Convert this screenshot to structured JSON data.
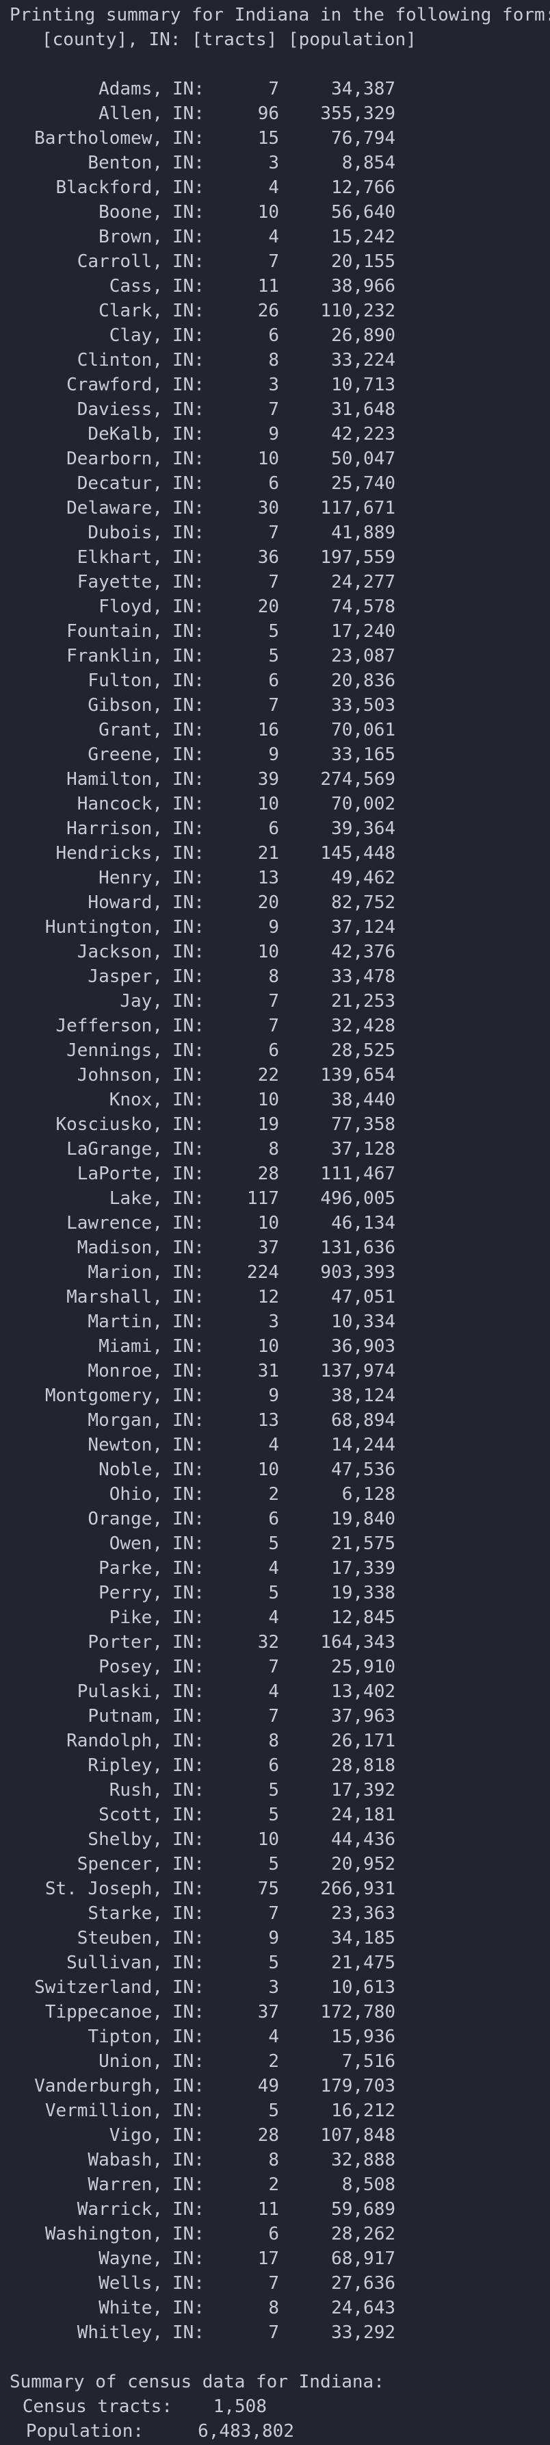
{
  "header": {
    "line1": "Printing summary for Indiana in the following form:",
    "line2": "   [county], IN: [tracts] [population]"
  },
  "state_abbr": "IN:",
  "rows": [
    {
      "county": "Adams,",
      "tracts": "7",
      "population": "34,387"
    },
    {
      "county": "Allen,",
      "tracts": "96",
      "population": "355,329"
    },
    {
      "county": "Bartholomew,",
      "tracts": "15",
      "population": "76,794"
    },
    {
      "county": "Benton,",
      "tracts": "3",
      "population": "8,854"
    },
    {
      "county": "Blackford,",
      "tracts": "4",
      "population": "12,766"
    },
    {
      "county": "Boone,",
      "tracts": "10",
      "population": "56,640"
    },
    {
      "county": "Brown,",
      "tracts": "4",
      "population": "15,242"
    },
    {
      "county": "Carroll,",
      "tracts": "7",
      "population": "20,155"
    },
    {
      "county": "Cass,",
      "tracts": "11",
      "population": "38,966"
    },
    {
      "county": "Clark,",
      "tracts": "26",
      "population": "110,232"
    },
    {
      "county": "Clay,",
      "tracts": "6",
      "population": "26,890"
    },
    {
      "county": "Clinton,",
      "tracts": "8",
      "population": "33,224"
    },
    {
      "county": "Crawford,",
      "tracts": "3",
      "population": "10,713"
    },
    {
      "county": "Daviess,",
      "tracts": "7",
      "population": "31,648"
    },
    {
      "county": "DeKalb,",
      "tracts": "9",
      "population": "42,223"
    },
    {
      "county": "Dearborn,",
      "tracts": "10",
      "population": "50,047"
    },
    {
      "county": "Decatur,",
      "tracts": "6",
      "population": "25,740"
    },
    {
      "county": "Delaware,",
      "tracts": "30",
      "population": "117,671"
    },
    {
      "county": "Dubois,",
      "tracts": "7",
      "population": "41,889"
    },
    {
      "county": "Elkhart,",
      "tracts": "36",
      "population": "197,559"
    },
    {
      "county": "Fayette,",
      "tracts": "7",
      "population": "24,277"
    },
    {
      "county": "Floyd,",
      "tracts": "20",
      "population": "74,578"
    },
    {
      "county": "Fountain,",
      "tracts": "5",
      "population": "17,240"
    },
    {
      "county": "Franklin,",
      "tracts": "5",
      "population": "23,087"
    },
    {
      "county": "Fulton,",
      "tracts": "6",
      "population": "20,836"
    },
    {
      "county": "Gibson,",
      "tracts": "7",
      "population": "33,503"
    },
    {
      "county": "Grant,",
      "tracts": "16",
      "population": "70,061"
    },
    {
      "county": "Greene,",
      "tracts": "9",
      "population": "33,165"
    },
    {
      "county": "Hamilton,",
      "tracts": "39",
      "population": "274,569"
    },
    {
      "county": "Hancock,",
      "tracts": "10",
      "population": "70,002"
    },
    {
      "county": "Harrison,",
      "tracts": "6",
      "population": "39,364"
    },
    {
      "county": "Hendricks,",
      "tracts": "21",
      "population": "145,448"
    },
    {
      "county": "Henry,",
      "tracts": "13",
      "population": "49,462"
    },
    {
      "county": "Howard,",
      "tracts": "20",
      "population": "82,752"
    },
    {
      "county": "Huntington,",
      "tracts": "9",
      "population": "37,124"
    },
    {
      "county": "Jackson,",
      "tracts": "10",
      "population": "42,376"
    },
    {
      "county": "Jasper,",
      "tracts": "8",
      "population": "33,478"
    },
    {
      "county": "Jay,",
      "tracts": "7",
      "population": "21,253"
    },
    {
      "county": "Jefferson,",
      "tracts": "7",
      "population": "32,428"
    },
    {
      "county": "Jennings,",
      "tracts": "6",
      "population": "28,525"
    },
    {
      "county": "Johnson,",
      "tracts": "22",
      "population": "139,654"
    },
    {
      "county": "Knox,",
      "tracts": "10",
      "population": "38,440"
    },
    {
      "county": "Kosciusko,",
      "tracts": "19",
      "population": "77,358"
    },
    {
      "county": "LaGrange,",
      "tracts": "8",
      "population": "37,128"
    },
    {
      "county": "LaPorte,",
      "tracts": "28",
      "population": "111,467"
    },
    {
      "county": "Lake,",
      "tracts": "117",
      "population": "496,005"
    },
    {
      "county": "Lawrence,",
      "tracts": "10",
      "population": "46,134"
    },
    {
      "county": "Madison,",
      "tracts": "37",
      "population": "131,636"
    },
    {
      "county": "Marion,",
      "tracts": "224",
      "population": "903,393"
    },
    {
      "county": "Marshall,",
      "tracts": "12",
      "population": "47,051"
    },
    {
      "county": "Martin,",
      "tracts": "3",
      "population": "10,334"
    },
    {
      "county": "Miami,",
      "tracts": "10",
      "population": "36,903"
    },
    {
      "county": "Monroe,",
      "tracts": "31",
      "population": "137,974"
    },
    {
      "county": "Montgomery,",
      "tracts": "9",
      "population": "38,124"
    },
    {
      "county": "Morgan,",
      "tracts": "13",
      "population": "68,894"
    },
    {
      "county": "Newton,",
      "tracts": "4",
      "population": "14,244"
    },
    {
      "county": "Noble,",
      "tracts": "10",
      "population": "47,536"
    },
    {
      "county": "Ohio,",
      "tracts": "2",
      "population": "6,128"
    },
    {
      "county": "Orange,",
      "tracts": "6",
      "population": "19,840"
    },
    {
      "county": "Owen,",
      "tracts": "5",
      "population": "21,575"
    },
    {
      "county": "Parke,",
      "tracts": "4",
      "population": "17,339"
    },
    {
      "county": "Perry,",
      "tracts": "5",
      "population": "19,338"
    },
    {
      "county": "Pike,",
      "tracts": "4",
      "population": "12,845"
    },
    {
      "county": "Porter,",
      "tracts": "32",
      "population": "164,343"
    },
    {
      "county": "Posey,",
      "tracts": "7",
      "population": "25,910"
    },
    {
      "county": "Pulaski,",
      "tracts": "4",
      "population": "13,402"
    },
    {
      "county": "Putnam,",
      "tracts": "7",
      "population": "37,963"
    },
    {
      "county": "Randolph,",
      "tracts": "8",
      "population": "26,171"
    },
    {
      "county": "Ripley,",
      "tracts": "6",
      "population": "28,818"
    },
    {
      "county": "Rush,",
      "tracts": "5",
      "population": "17,392"
    },
    {
      "county": "Scott,",
      "tracts": "5",
      "population": "24,181"
    },
    {
      "county": "Shelby,",
      "tracts": "10",
      "population": "44,436"
    },
    {
      "county": "Spencer,",
      "tracts": "5",
      "population": "20,952"
    },
    {
      "county": "St. Joseph,",
      "tracts": "75",
      "population": "266,931"
    },
    {
      "county": "Starke,",
      "tracts": "7",
      "population": "23,363"
    },
    {
      "county": "Steuben,",
      "tracts": "9",
      "population": "34,185"
    },
    {
      "county": "Sullivan,",
      "tracts": "5",
      "population": "21,475"
    },
    {
      "county": "Switzerland,",
      "tracts": "3",
      "population": "10,613"
    },
    {
      "county": "Tippecanoe,",
      "tracts": "37",
      "population": "172,780"
    },
    {
      "county": "Tipton,",
      "tracts": "4",
      "population": "15,936"
    },
    {
      "county": "Union,",
      "tracts": "2",
      "population": "7,516"
    },
    {
      "county": "Vanderburgh,",
      "tracts": "49",
      "population": "179,703"
    },
    {
      "county": "Vermillion,",
      "tracts": "5",
      "population": "16,212"
    },
    {
      "county": "Vigo,",
      "tracts": "28",
      "population": "107,848"
    },
    {
      "county": "Wabash,",
      "tracts": "8",
      "population": "32,888"
    },
    {
      "county": "Warren,",
      "tracts": "2",
      "population": "8,508"
    },
    {
      "county": "Warrick,",
      "tracts": "11",
      "population": "59,689"
    },
    {
      "county": "Washington,",
      "tracts": "6",
      "population": "28,262"
    },
    {
      "county": "Wayne,",
      "tracts": "17",
      "population": "68,917"
    },
    {
      "county": "Wells,",
      "tracts": "7",
      "population": "27,636"
    },
    {
      "county": "White,",
      "tracts": "8",
      "population": "24,643"
    },
    {
      "county": "Whitley,",
      "tracts": "7",
      "population": "33,292"
    }
  ],
  "summary": {
    "title": "Summary of census data for Indiana:",
    "tracts_label": "Census tracts:",
    "tracts_value": "1,508",
    "population_label": "Population:",
    "population_value": "6,483,802"
  }
}
